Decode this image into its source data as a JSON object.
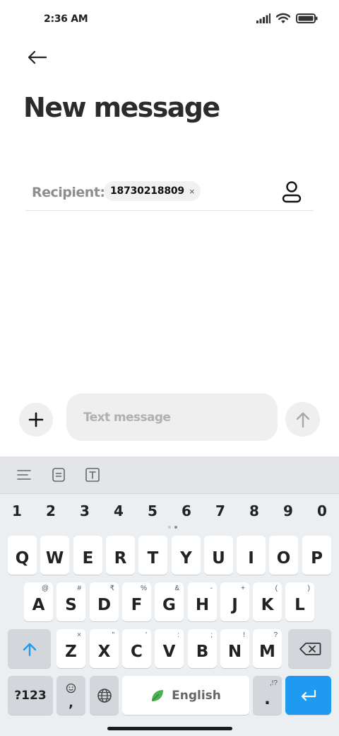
{
  "status_bar": {
    "time": "2:36 AM"
  },
  "header": {
    "title": "New message"
  },
  "recipient": {
    "label": "Recipient:",
    "chips": [
      {
        "text": "18730218809",
        "remove": "×"
      }
    ]
  },
  "composer": {
    "placeholder": "Text message"
  },
  "keyboard": {
    "numbers": [
      "1",
      "2",
      "3",
      "4",
      "5",
      "6",
      "7",
      "8",
      "9",
      "0"
    ],
    "row1": [
      {
        "key": "Q",
        "sub": ""
      },
      {
        "key": "W",
        "sub": ""
      },
      {
        "key": "E",
        "sub": ""
      },
      {
        "key": "R",
        "sub": ""
      },
      {
        "key": "T",
        "sub": ""
      },
      {
        "key": "Y",
        "sub": ""
      },
      {
        "key": "U",
        "sub": ""
      },
      {
        "key": "I",
        "sub": ""
      },
      {
        "key": "O",
        "sub": ""
      },
      {
        "key": "P",
        "sub": ""
      }
    ],
    "row2": [
      {
        "key": "A",
        "sub": "@"
      },
      {
        "key": "S",
        "sub": "#"
      },
      {
        "key": "D",
        "sub": "₹"
      },
      {
        "key": "F",
        "sub": "%"
      },
      {
        "key": "G",
        "sub": "&"
      },
      {
        "key": "H",
        "sub": "-"
      },
      {
        "key": "J",
        "sub": "+"
      },
      {
        "key": "K",
        "sub": "("
      },
      {
        "key": "L",
        "sub": ")"
      }
    ],
    "row3": [
      {
        "key": "Z",
        "sub": "×"
      },
      {
        "key": "X",
        "sub": "\""
      },
      {
        "key": "C",
        "sub": "'"
      },
      {
        "key": "V",
        "sub": ":"
      },
      {
        "key": "B",
        "sub": ";"
      },
      {
        "key": "N",
        "sub": "!"
      },
      {
        "key": "M",
        "sub": "?"
      }
    ],
    "symbols_label": "?123",
    "emoji_comma": ",",
    "space_label": "English",
    "period": ".",
    "period_sub": ",!?"
  },
  "colors": {
    "accent": "#1e9bf0",
    "keyboard_bg": "#eceff2",
    "leaf": "#4caf50"
  }
}
